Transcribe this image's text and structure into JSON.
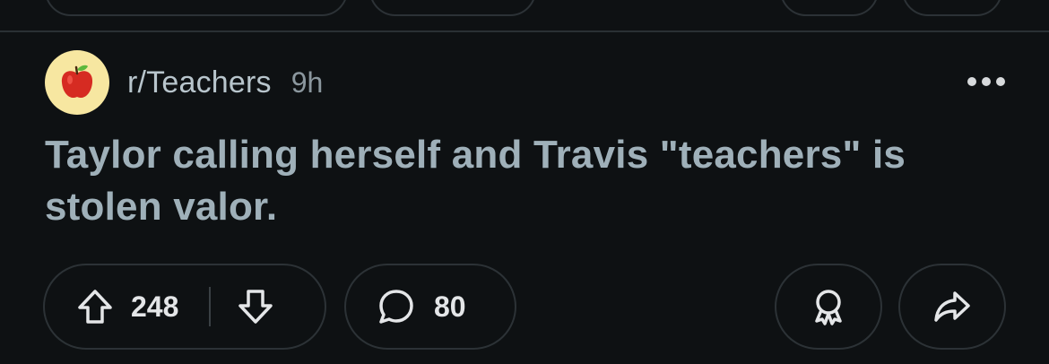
{
  "post": {
    "subreddit": "r/Teachers",
    "time": "9h",
    "title": "Taylor calling herself and Travis \"teachers\" is stolen valor.",
    "avatar_icon": "apple-icon",
    "colors": {
      "background": "#0e1113",
      "title": "#9fb0b9",
      "avatar_bg": "#f7e7a1",
      "apple": "#d62b22",
      "leaf": "#5cb83c"
    }
  },
  "actions": {
    "upvote_icon": "arrow-up-icon",
    "upvotes": "248",
    "downvote_icon": "arrow-down-icon",
    "comment_icon": "comment-bubble-icon",
    "comments": "80",
    "award_icon": "award-icon",
    "share_icon": "share-icon"
  },
  "menu": {
    "more_icon": "ellipsis-icon"
  }
}
